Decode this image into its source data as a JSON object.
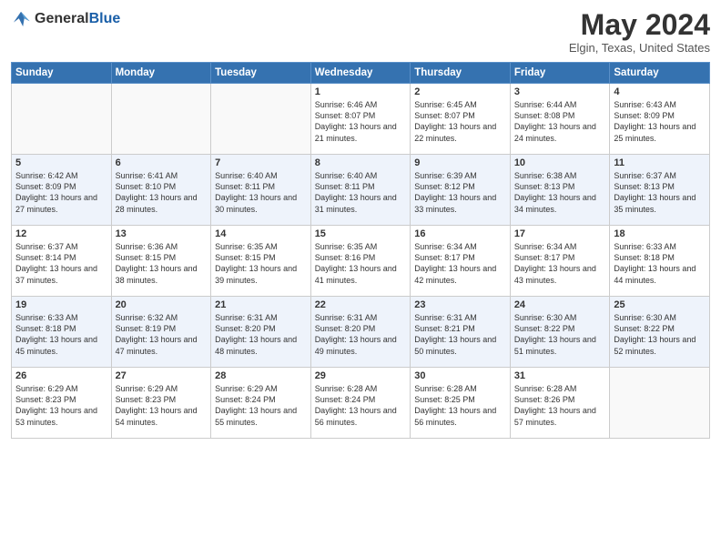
{
  "header": {
    "logo_general": "General",
    "logo_blue": "Blue",
    "month_year": "May 2024",
    "location": "Elgin, Texas, United States"
  },
  "weekdays": [
    "Sunday",
    "Monday",
    "Tuesday",
    "Wednesday",
    "Thursday",
    "Friday",
    "Saturday"
  ],
  "weeks": [
    [
      {
        "day": "",
        "info": ""
      },
      {
        "day": "",
        "info": ""
      },
      {
        "day": "",
        "info": ""
      },
      {
        "day": "1",
        "info": "Sunrise: 6:46 AM\nSunset: 8:07 PM\nDaylight: 13 hours and 21 minutes."
      },
      {
        "day": "2",
        "info": "Sunrise: 6:45 AM\nSunset: 8:07 PM\nDaylight: 13 hours and 22 minutes."
      },
      {
        "day": "3",
        "info": "Sunrise: 6:44 AM\nSunset: 8:08 PM\nDaylight: 13 hours and 24 minutes."
      },
      {
        "day": "4",
        "info": "Sunrise: 6:43 AM\nSunset: 8:09 PM\nDaylight: 13 hours and 25 minutes."
      }
    ],
    [
      {
        "day": "5",
        "info": "Sunrise: 6:42 AM\nSunset: 8:09 PM\nDaylight: 13 hours and 27 minutes."
      },
      {
        "day": "6",
        "info": "Sunrise: 6:41 AM\nSunset: 8:10 PM\nDaylight: 13 hours and 28 minutes."
      },
      {
        "day": "7",
        "info": "Sunrise: 6:40 AM\nSunset: 8:11 PM\nDaylight: 13 hours and 30 minutes."
      },
      {
        "day": "8",
        "info": "Sunrise: 6:40 AM\nSunset: 8:11 PM\nDaylight: 13 hours and 31 minutes."
      },
      {
        "day": "9",
        "info": "Sunrise: 6:39 AM\nSunset: 8:12 PM\nDaylight: 13 hours and 33 minutes."
      },
      {
        "day": "10",
        "info": "Sunrise: 6:38 AM\nSunset: 8:13 PM\nDaylight: 13 hours and 34 minutes."
      },
      {
        "day": "11",
        "info": "Sunrise: 6:37 AM\nSunset: 8:13 PM\nDaylight: 13 hours and 35 minutes."
      }
    ],
    [
      {
        "day": "12",
        "info": "Sunrise: 6:37 AM\nSunset: 8:14 PM\nDaylight: 13 hours and 37 minutes."
      },
      {
        "day": "13",
        "info": "Sunrise: 6:36 AM\nSunset: 8:15 PM\nDaylight: 13 hours and 38 minutes."
      },
      {
        "day": "14",
        "info": "Sunrise: 6:35 AM\nSunset: 8:15 PM\nDaylight: 13 hours and 39 minutes."
      },
      {
        "day": "15",
        "info": "Sunrise: 6:35 AM\nSunset: 8:16 PM\nDaylight: 13 hours and 41 minutes."
      },
      {
        "day": "16",
        "info": "Sunrise: 6:34 AM\nSunset: 8:17 PM\nDaylight: 13 hours and 42 minutes."
      },
      {
        "day": "17",
        "info": "Sunrise: 6:34 AM\nSunset: 8:17 PM\nDaylight: 13 hours and 43 minutes."
      },
      {
        "day": "18",
        "info": "Sunrise: 6:33 AM\nSunset: 8:18 PM\nDaylight: 13 hours and 44 minutes."
      }
    ],
    [
      {
        "day": "19",
        "info": "Sunrise: 6:33 AM\nSunset: 8:18 PM\nDaylight: 13 hours and 45 minutes."
      },
      {
        "day": "20",
        "info": "Sunrise: 6:32 AM\nSunset: 8:19 PM\nDaylight: 13 hours and 47 minutes."
      },
      {
        "day": "21",
        "info": "Sunrise: 6:31 AM\nSunset: 8:20 PM\nDaylight: 13 hours and 48 minutes."
      },
      {
        "day": "22",
        "info": "Sunrise: 6:31 AM\nSunset: 8:20 PM\nDaylight: 13 hours and 49 minutes."
      },
      {
        "day": "23",
        "info": "Sunrise: 6:31 AM\nSunset: 8:21 PM\nDaylight: 13 hours and 50 minutes."
      },
      {
        "day": "24",
        "info": "Sunrise: 6:30 AM\nSunset: 8:22 PM\nDaylight: 13 hours and 51 minutes."
      },
      {
        "day": "25",
        "info": "Sunrise: 6:30 AM\nSunset: 8:22 PM\nDaylight: 13 hours and 52 minutes."
      }
    ],
    [
      {
        "day": "26",
        "info": "Sunrise: 6:29 AM\nSunset: 8:23 PM\nDaylight: 13 hours and 53 minutes."
      },
      {
        "day": "27",
        "info": "Sunrise: 6:29 AM\nSunset: 8:23 PM\nDaylight: 13 hours and 54 minutes."
      },
      {
        "day": "28",
        "info": "Sunrise: 6:29 AM\nSunset: 8:24 PM\nDaylight: 13 hours and 55 minutes."
      },
      {
        "day": "29",
        "info": "Sunrise: 6:28 AM\nSunset: 8:24 PM\nDaylight: 13 hours and 56 minutes."
      },
      {
        "day": "30",
        "info": "Sunrise: 6:28 AM\nSunset: 8:25 PM\nDaylight: 13 hours and 56 minutes."
      },
      {
        "day": "31",
        "info": "Sunrise: 6:28 AM\nSunset: 8:26 PM\nDaylight: 13 hours and 57 minutes."
      },
      {
        "day": "",
        "info": ""
      }
    ]
  ]
}
